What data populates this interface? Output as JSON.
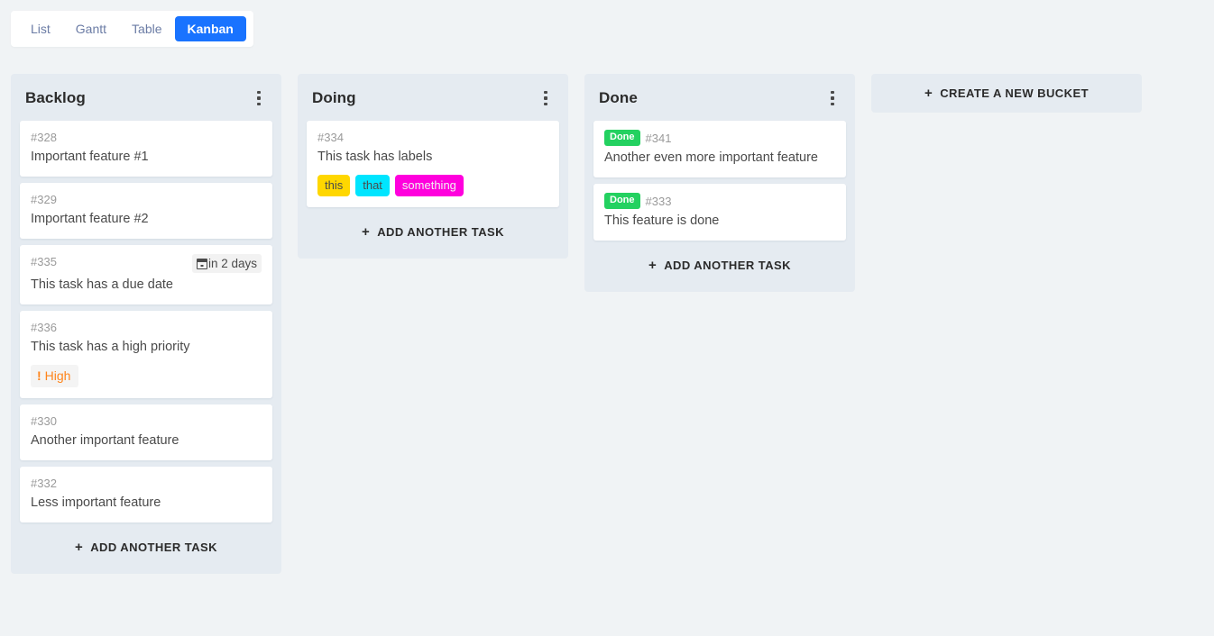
{
  "view_switcher": {
    "tabs": [
      {
        "label": "List",
        "active": false
      },
      {
        "label": "Gantt",
        "active": false
      },
      {
        "label": "Table",
        "active": false
      },
      {
        "label": "Kanban",
        "active": true
      }
    ]
  },
  "kanban": {
    "add_task_label": "Add another task",
    "create_bucket_label": "Create a new bucket",
    "menu_icon": "dots-vertical-icon",
    "plus_icon": "plus-icon",
    "buckets": [
      {
        "title": "Backlog",
        "tasks": [
          {
            "id": "#328",
            "title": "Important feature #1"
          },
          {
            "id": "#329",
            "title": "Important feature #2"
          },
          {
            "id": "#335",
            "title": "This task has a due date",
            "due": "in 2 days",
            "due_icon": "calendar-icon"
          },
          {
            "id": "#336",
            "title": "This task has a high priority",
            "priority": "High",
            "priority_icon": "exclamation-icon"
          },
          {
            "id": "#330",
            "title": "Another important feature"
          },
          {
            "id": "#332",
            "title": "Less important feature"
          }
        ]
      },
      {
        "title": "Doing",
        "tasks": [
          {
            "id": "#334",
            "title": "This task has labels",
            "labels": [
              {
                "text": "this",
                "bg": "#ffd700",
                "fg": "#4a4a4a"
              },
              {
                "text": "that",
                "bg": "#00e5ff",
                "fg": "#4a4a4a"
              },
              {
                "text": "something",
                "bg": "#ff00dd",
                "fg": "#f2f2f2"
              }
            ]
          }
        ]
      },
      {
        "title": "Done",
        "tasks": [
          {
            "id": "#341",
            "title": "Another even more important feature",
            "done_badge": "Done"
          },
          {
            "id": "#333",
            "title": "This feature is done",
            "done_badge": "Done"
          }
        ]
      }
    ]
  },
  "colors": {
    "page_bg": "#f0f3f5",
    "bucket_bg": "#e5ebf1",
    "card_bg": "#ffffff",
    "accent": "#1973ff",
    "done_green": "#23d160",
    "priority_orange": "#ff851b"
  }
}
